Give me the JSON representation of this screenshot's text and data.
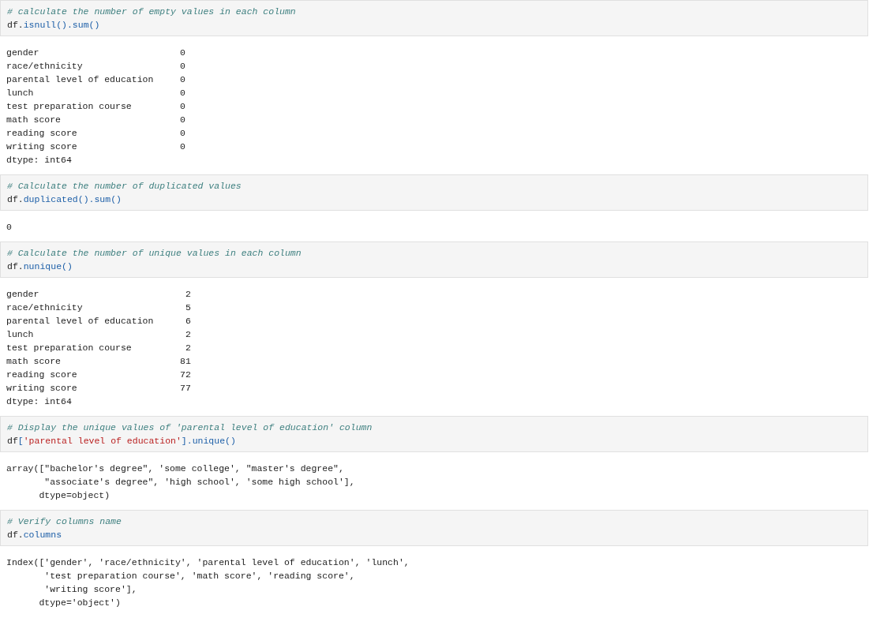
{
  "cells": [
    {
      "comment": "# calculate the number of empty values in each column",
      "code": [
        {
          "kind": "plain",
          "text": "df."
        },
        {
          "kind": "call",
          "text": "isnull().sum()"
        }
      ],
      "output": {
        "kind": "series",
        "rows": [
          {
            "name": "gender",
            "value": "0"
          },
          {
            "name": "race/ethnicity",
            "value": "0"
          },
          {
            "name": "parental level of education",
            "value": "0"
          },
          {
            "name": "lunch",
            "value": "0"
          },
          {
            "name": "test preparation course",
            "value": "0"
          },
          {
            "name": "math score",
            "value": "0"
          },
          {
            "name": "reading score",
            "value": "0"
          },
          {
            "name": "writing score",
            "value": "0"
          }
        ],
        "dtype": "dtype: int64"
      }
    },
    {
      "comment": "# Calculate the number of duplicated values",
      "code": [
        {
          "kind": "plain",
          "text": "df."
        },
        {
          "kind": "call",
          "text": "duplicated().sum()"
        }
      ],
      "output": {
        "kind": "text",
        "lines": [
          "0"
        ]
      }
    },
    {
      "comment": "# Calculate the number of unique values in each column",
      "code": [
        {
          "kind": "plain",
          "text": "df."
        },
        {
          "kind": "call",
          "text": "nunique()"
        }
      ],
      "output": {
        "kind": "series",
        "rows": [
          {
            "name": "gender",
            "value": "2"
          },
          {
            "name": "race/ethnicity",
            "value": "5"
          },
          {
            "name": "parental level of education",
            "value": "6"
          },
          {
            "name": "lunch",
            "value": "2"
          },
          {
            "name": "test preparation course",
            "value": "2"
          },
          {
            "name": "math score",
            "value": "81"
          },
          {
            "name": "reading score",
            "value": "72"
          },
          {
            "name": "writing score",
            "value": "77"
          }
        ],
        "dtype": "dtype: int64"
      }
    },
    {
      "comment": "# Display the unique values of 'parental level of education' column",
      "code": [
        {
          "kind": "plain",
          "text": "df"
        },
        {
          "kind": "call",
          "text": "["
        },
        {
          "kind": "string",
          "text": "'parental level of education'"
        },
        {
          "kind": "call",
          "text": "].unique()"
        }
      ],
      "output": {
        "kind": "text",
        "lines": [
          "array([\"bachelor's degree\", 'some college', \"master's degree\",",
          "       \"associate's degree\", 'high school', 'some high school'],",
          "      dtype=object)"
        ]
      }
    },
    {
      "comment": "# Verify columns name",
      "code": [
        {
          "kind": "plain",
          "text": "df."
        },
        {
          "kind": "call",
          "text": "columns"
        }
      ],
      "output": {
        "kind": "text",
        "lines": [
          "Index(['gender', 'race/ethnicity', 'parental level of education', 'lunch',",
          "       'test preparation course', 'math score', 'reading score',",
          "       'writing score'],",
          "      dtype='object')"
        ]
      }
    }
  ]
}
